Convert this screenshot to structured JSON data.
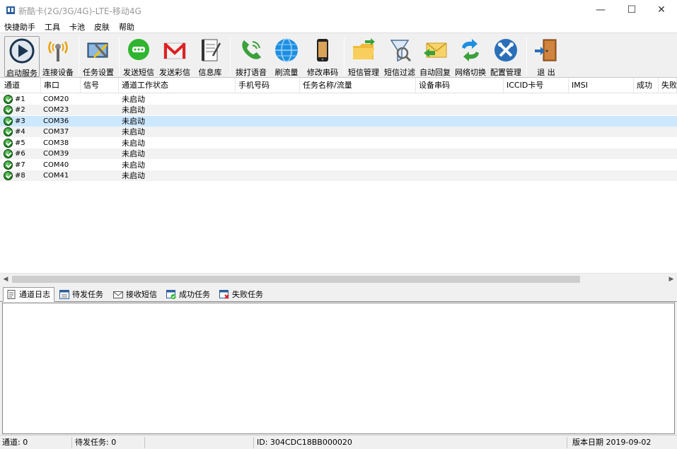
{
  "window": {
    "title": "新酷卡(2G/3G/4G)-LTE-移动4G",
    "minimize": "—",
    "maximize": "☐",
    "close": "✕"
  },
  "menu": [
    "快捷助手",
    "工具",
    "卡池",
    "皮肤",
    "帮助"
  ],
  "toolbar": [
    {
      "label": "启动服务",
      "icon": "play-icon"
    },
    {
      "label": "连接设备",
      "icon": "antenna-icon"
    },
    {
      "label": "任务设置",
      "icon": "task-settings-icon"
    },
    {
      "label": "发送短信",
      "icon": "sms-bubble-icon"
    },
    {
      "label": "发送彩信",
      "icon": "mms-mail-icon"
    },
    {
      "label": "信息库",
      "icon": "notebook-icon"
    },
    {
      "label": "拨打语音",
      "icon": "phone-icon"
    },
    {
      "label": "刷流量",
      "icon": "globe-icon"
    },
    {
      "label": "修改串码",
      "icon": "mobile-phone-icon"
    },
    {
      "label": "短信管理",
      "icon": "folder-icon"
    },
    {
      "label": "短信过滤",
      "icon": "filter-icon"
    },
    {
      "label": "自动回复",
      "icon": "auto-reply-icon"
    },
    {
      "label": "网络切换",
      "icon": "switch-arrows-icon"
    },
    {
      "label": "配置管理",
      "icon": "tools-icon"
    },
    {
      "label": "退 出",
      "icon": "exit-door-icon"
    }
  ],
  "grid": {
    "columns": [
      "通道",
      "串口",
      "信号",
      "通道工作状态",
      "手机号码",
      "任务名称/流量",
      "设备串码",
      "ICCID卡号",
      "IMSI",
      "成功",
      "失败"
    ],
    "rows": [
      {
        "channel": "#1",
        "port": "COM20",
        "status": "未启动"
      },
      {
        "channel": "#2",
        "port": "COM23",
        "status": "未启动"
      },
      {
        "channel": "#3",
        "port": "COM36",
        "status": "未启动"
      },
      {
        "channel": "#4",
        "port": "COM37",
        "status": "未启动"
      },
      {
        "channel": "#5",
        "port": "COM38",
        "status": "未启动"
      },
      {
        "channel": "#6",
        "port": "COM39",
        "status": "未启动"
      },
      {
        "channel": "#7",
        "port": "COM40",
        "status": "未启动"
      },
      {
        "channel": "#8",
        "port": "COM41",
        "status": "未启动"
      }
    ],
    "selected_row": "#3"
  },
  "tabs": [
    {
      "label": "通道日志",
      "icon": "log-icon"
    },
    {
      "label": "待发任务",
      "icon": "pending-task-icon"
    },
    {
      "label": "接收短信",
      "icon": "inbox-mail-icon"
    },
    {
      "label": "成功任务",
      "icon": "success-task-icon"
    },
    {
      "label": "失败任务",
      "icon": "failed-task-icon"
    }
  ],
  "active_tab": "通道日志",
  "statusbar": {
    "channels": "通道: 0",
    "pending": "待发任务: 0",
    "device_id": "ID: 304CDC18BB000020",
    "version": "版本日期  2019-09-02"
  }
}
